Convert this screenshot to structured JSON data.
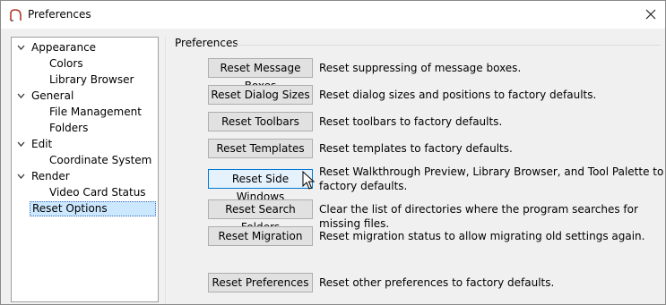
{
  "window": {
    "title": "Preferences"
  },
  "tree": [
    {
      "label": "Appearance",
      "level": 0,
      "expanded": true
    },
    {
      "label": "Colors",
      "level": 1
    },
    {
      "label": "Library Browser",
      "level": 1
    },
    {
      "label": "General",
      "level": 0,
      "expanded": true
    },
    {
      "label": "File Management",
      "level": 1
    },
    {
      "label": "Folders",
      "level": 1
    },
    {
      "label": "Edit",
      "level": 0,
      "expanded": true
    },
    {
      "label": "Coordinate System",
      "level": 1
    },
    {
      "label": "Render",
      "level": 0,
      "expanded": true
    },
    {
      "label": "Video Card Status",
      "level": 1
    },
    {
      "label": "Reset Options",
      "level": 0,
      "selected": true
    }
  ],
  "panel": {
    "group_label": "Preferences",
    "rows": [
      {
        "button": "Reset Message Boxes",
        "desc": "Reset suppressing of message boxes."
      },
      {
        "button": "Reset Dialog Sizes",
        "desc": "Reset dialog sizes and positions to factory defaults."
      },
      {
        "button": "Reset Toolbars",
        "desc": "Reset toolbars to factory defaults."
      },
      {
        "button": "Reset Templates",
        "desc": "Reset templates to factory defaults."
      },
      {
        "button": "Reset Side Windows",
        "desc": "Reset Walkthrough Preview, Library Browser, and Tool Palette to factory defaults.",
        "focused": true
      },
      {
        "button": "Reset Search Folders",
        "desc": "Clear the list of directories where the program searches for missing files."
      },
      {
        "button": "Reset Migration",
        "desc": "Reset migration status to allow migrating old settings again."
      },
      {
        "button": "Reset Preferences",
        "desc": "Reset other preferences to factory defaults."
      }
    ]
  },
  "colors": {
    "selection": "#cce8ff",
    "focus_border": "#0078d7",
    "app_icon": "#b33a2a"
  }
}
